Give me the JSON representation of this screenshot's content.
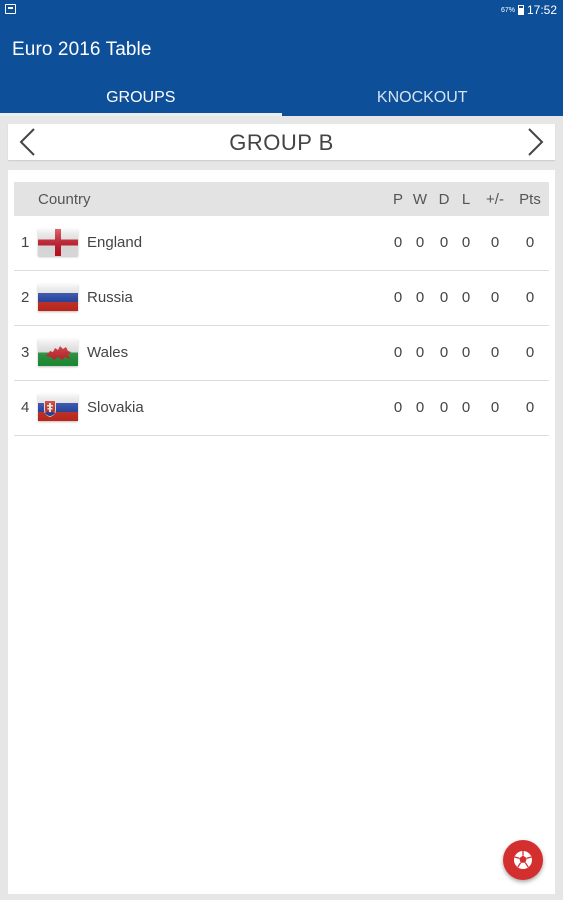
{
  "status_bar": {
    "battery_percent": "67%",
    "time": "17:52"
  },
  "app_bar": {
    "title": "Euro 2016 Table"
  },
  "tabs": [
    {
      "label": "GROUPS",
      "active": true
    },
    {
      "label": "KNOCKOUT",
      "active": false
    }
  ],
  "group": {
    "title": "GROUP B",
    "prev_icon": "chevron-left-icon",
    "next_icon": "chevron-right-icon"
  },
  "table": {
    "headers": {
      "country": "Country",
      "p": "P",
      "w": "W",
      "d": "D",
      "l": "L",
      "gd": "+/-",
      "pts": "Pts"
    },
    "rows": [
      {
        "rank": "1",
        "country": "England",
        "flag": "england-flag",
        "p": "0",
        "w": "0",
        "d": "0",
        "l": "0",
        "gd": "0",
        "pts": "0"
      },
      {
        "rank": "2",
        "country": "Russia",
        "flag": "russia-flag",
        "p": "0",
        "w": "0",
        "d": "0",
        "l": "0",
        "gd": "0",
        "pts": "0"
      },
      {
        "rank": "3",
        "country": "Wales",
        "flag": "wales-flag",
        "p": "0",
        "w": "0",
        "d": "0",
        "l": "0",
        "gd": "0",
        "pts": "0"
      },
      {
        "rank": "4",
        "country": "Slovakia",
        "flag": "slovakia-flag",
        "p": "0",
        "w": "0",
        "d": "0",
        "l": "0",
        "gd": "0",
        "pts": "0"
      }
    ]
  },
  "fab": {
    "icon": "soccer-ball-icon"
  },
  "colors": {
    "primary": "#0d4f98",
    "accent": "#d32f2f",
    "background": "#e6e6e6"
  }
}
